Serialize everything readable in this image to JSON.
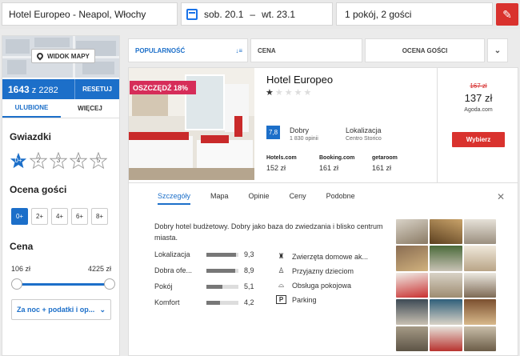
{
  "search": {
    "destination": "Hotel Europeo - Neapol, Włochy",
    "date_from": "sob. 20.1",
    "date_sep": "–",
    "date_to": "wt. 23.1",
    "rooms_guests": "1 pokój, 2 gości"
  },
  "sidebar": {
    "map_label": "WIDOK MAPY",
    "count": "1643",
    "count_total": "z 2282",
    "reset": "RESETUJ",
    "tab_favorites": "ULUBIONE",
    "tab_more": "WIĘCEJ",
    "stars_title": "Gwiazdki",
    "stars": [
      "0+",
      "2",
      "3",
      "4",
      "5"
    ],
    "guest_title": "Ocena gości",
    "guest_options": [
      "0+",
      "2+",
      "4+",
      "6+",
      "8+"
    ],
    "price_title": "Cena",
    "price_min": "106 zł",
    "price_max": "4225 zł",
    "price_select": "Za noc + podatki i op..."
  },
  "sort": {
    "popularity": "POPULARNOŚĆ",
    "price": "CENA",
    "rating": "OCENA GOŚCI"
  },
  "hotel": {
    "badge": "OSZCZĘDŹ 18%",
    "name": "Hotel Europeo",
    "stars": 1,
    "score": "7,8",
    "score_text": "Dobry",
    "reviews": "1 830 opinii",
    "location_label": "Lokalizacja",
    "location_value": "Centro Storico",
    "providers": [
      {
        "name": "Hotels.com",
        "price": "152 zł"
      },
      {
        "name": "Booking.com",
        "price": "161 zł"
      },
      {
        "name": "getaroom",
        "price": "161 zł"
      }
    ],
    "old_price": "167 zł",
    "price": "137 zł",
    "price_source": "Agoda.com",
    "choose": "Wybierz"
  },
  "details": {
    "tabs": [
      "Szczegóły",
      "Mapa",
      "Opinie",
      "Ceny",
      "Podobne"
    ],
    "description": "Dobry hotel budżetowy. Dobry jako baza do zwiedzania i blisko centrum miasta.",
    "ratings": [
      {
        "label": "Lokalizacja",
        "value": "9,3",
        "fill": 0.93
      },
      {
        "label": "Dobra ofe...",
        "value": "8,9",
        "fill": 0.89
      },
      {
        "label": "Pokój",
        "value": "5,1",
        "fill": 0.51
      },
      {
        "label": "Komfort",
        "value": "4,2",
        "fill": 0.42
      }
    ],
    "amenities": [
      {
        "icon": "trophy-icon",
        "label": "Zwierzęta domowe ak..."
      },
      {
        "icon": "child-icon",
        "label": "Przyjazny dzieciom"
      },
      {
        "icon": "service-bell-icon",
        "label": "Obsługa pokojowa"
      },
      {
        "icon": "parking-icon",
        "label": "Parking"
      }
    ]
  }
}
